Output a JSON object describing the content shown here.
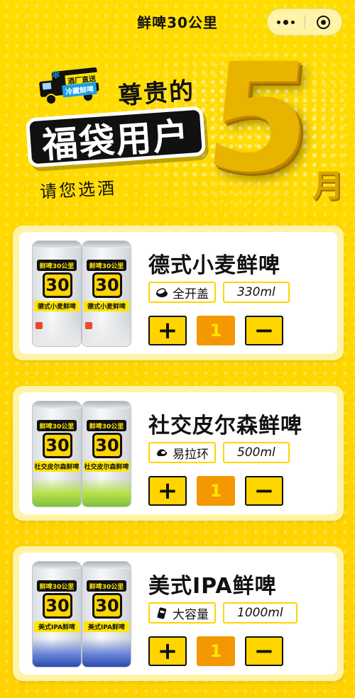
{
  "nav": {
    "title": "鲜啤30公里"
  },
  "banner": {
    "truck_tag_top": "酒厂直送",
    "truck_tag_bottom": "冷藏鲜啤",
    "title_line1": "尊贵的",
    "title_line2": "福袋用户",
    "subtitle": "请您选酒",
    "month_number": "5",
    "month_unit": "月"
  },
  "products": [
    {
      "name": "德式小麦鲜啤",
      "feature_label": "全开盖",
      "feature_icon": "open-lid-icon",
      "volume": "330ml",
      "quantity": "1",
      "can_brand": "鲜啤30公里",
      "can_number": "30",
      "can_name": "德式小麦鲜啤",
      "band_color": "#e9e9e9"
    },
    {
      "name": "社交皮尔森鲜啤",
      "feature_label": "易拉环",
      "feature_icon": "pull-ring-icon",
      "volume": "500ml",
      "quantity": "1",
      "can_brand": "鲜啤30公里",
      "can_number": "30",
      "can_name": "社交皮尔森鲜啤",
      "band_color": "#7cc13a"
    },
    {
      "name": "美式IPA鲜啤",
      "feature_label": "大容量",
      "feature_icon": "large-can-icon",
      "volume": "1000ml",
      "quantity": "1",
      "can_brand": "鲜啤30公里",
      "can_number": "30",
      "can_name": "美式IPA鲜啤",
      "band_color": "#2a4ab0"
    }
  ],
  "stepper": {
    "plus": "+",
    "minus": "−"
  },
  "colors": {
    "brand_yellow": "#FFD400",
    "qty_orange": "#F39800",
    "text_dark": "#111111"
  }
}
